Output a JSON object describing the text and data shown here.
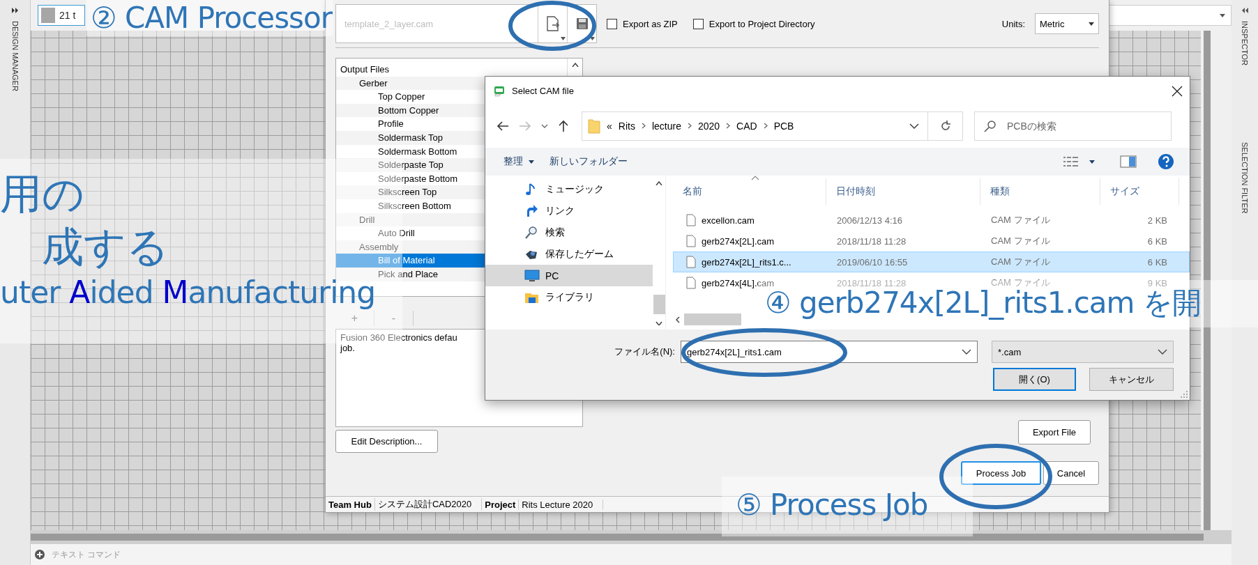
{
  "app": {
    "layer_dropdown": "21 t",
    "left_panel": "DESIGN MANAGER",
    "right_panels": [
      "INSPECTOR",
      "SELECTION FILTER"
    ],
    "command_line": {
      "placeholder": "テキスト コマンド"
    }
  },
  "cam_processor": {
    "job_file": "template_2_layer.cam",
    "options": [
      {
        "label": "Export as ZIP",
        "checked": false
      },
      {
        "label": "Export to Project Directory",
        "checked": false
      }
    ],
    "units_label": "Units:",
    "units": "Metric",
    "output_tree": {
      "label": "Output Files",
      "selected": false,
      "children": [
        {
          "label": "Gerber",
          "selected": false,
          "children": [
            {
              "label": "Top Copper",
              "selected": false
            },
            {
              "label": "Bottom Copper",
              "selected": false
            },
            {
              "label": "Profile",
              "selected": false
            },
            {
              "label": "Soldermask Top",
              "selected": false
            },
            {
              "label": "Soldermask Bottom",
              "selected": false
            },
            {
              "label": "Solderpaste Top",
              "selected": false
            },
            {
              "label": "Solderpaste Bottom",
              "selected": false
            },
            {
              "label": "Silkscreen Top",
              "selected": false
            },
            {
              "label": "Silkscreen Bottom",
              "selected": false
            }
          ]
        },
        {
          "label": "Drill",
          "selected": false,
          "children": [
            {
              "label": "Auto Drill",
              "selected": false
            }
          ]
        },
        {
          "label": "Assembly",
          "selected": false,
          "children": [
            {
              "label": "Bill of Material",
              "selected": true
            },
            {
              "label": "Pick and Place",
              "selected": false
            }
          ]
        }
      ]
    },
    "tree_buttons": [
      "+",
      "-"
    ],
    "description": [
      "Fusion 360 Electronics defau",
      "job."
    ],
    "edit_description": "Edit Description...",
    "export_file": "Export File",
    "process_job": "Process Job",
    "cancel": "Cancel",
    "status_bar": [
      {
        "label": "Team Hub",
        "value": "システム設計CAD2020"
      },
      {
        "label": "Project",
        "value": "Rits Lecture 2020"
      }
    ]
  },
  "dialog": {
    "title": "Select CAM file",
    "overflow_mark": "«",
    "path": [
      "Rits",
      "lecture",
      "2020",
      "CAD",
      "PCB"
    ],
    "search": {
      "placeholder": "PCBの検索"
    },
    "organize": "整理",
    "new_folder": "新しいフォルダー",
    "nav": [
      {
        "label": "ミュージック",
        "kind": "music",
        "selected": false
      },
      {
        "label": "リンク",
        "kind": "link",
        "selected": false
      },
      {
        "label": "検索",
        "kind": "search",
        "selected": false
      },
      {
        "label": "保存したゲーム",
        "kind": "game",
        "selected": false
      },
      {
        "label": "PC",
        "kind": "pc",
        "selected": true
      },
      {
        "label": "ライブラリ",
        "kind": "library",
        "selected": false
      }
    ],
    "columns": [
      "名前",
      "日付時刻",
      "種類",
      "サイズ"
    ],
    "files": [
      {
        "name": "excellon.cam",
        "date": "2006/12/13 4:16",
        "type": "CAM ファイル",
        "size": "2 KB",
        "selected": false
      },
      {
        "name": "gerb274x[2L].cam",
        "date": "2018/11/18 11:28",
        "type": "CAM ファイル",
        "size": "6 KB",
        "selected": false
      },
      {
        "name": "gerb274x[2L]_rits1.c...",
        "date": "2019/06/10 16:55",
        "type": "CAM ファイル",
        "size": "6 KB",
        "selected": true
      },
      {
        "name": "gerb274x[4L].cam",
        "date": "2018/11/18 11:28",
        "type": "CAM ファイル",
        "size": "9 KB",
        "selected": false
      }
    ],
    "filename_label": "ファイル名(N):",
    "filename": "gerb274x[2L]_rits1.cam",
    "filter": "*.cam",
    "open": "開く(O)",
    "cancel": "キャンセル"
  },
  "annotations": [
    {
      "kind": "label",
      "text": "② CAM Processor"
    },
    {
      "kind": "block",
      "lines": [
        "用の",
        "成する"
      ],
      "segments": [
        {
          "text": "uter ",
          "highlight": false
        },
        {
          "text": "A",
          "highlight": true
        },
        {
          "text": "ided ",
          "highlight": false
        },
        {
          "text": "M",
          "highlight": true
        },
        {
          "text": "anufacturing",
          "highlight": false
        }
      ]
    },
    {
      "kind": "label",
      "text": "④ gerb274x[2L]_rits1.cam を開"
    },
    {
      "kind": "label",
      "text": "⑤ Process Job"
    }
  ]
}
